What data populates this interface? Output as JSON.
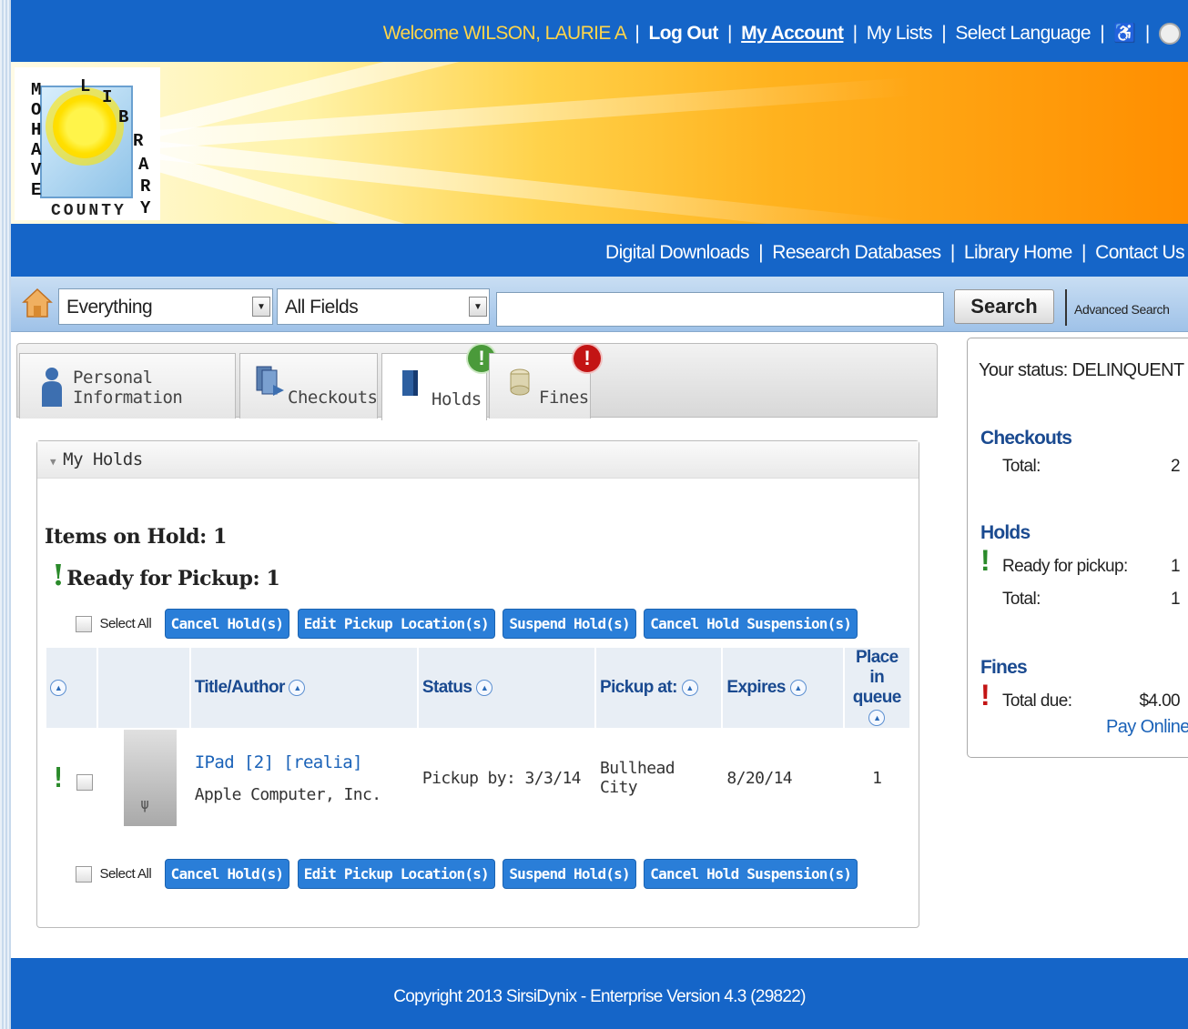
{
  "topbar": {
    "welcome": "Welcome WILSON, LAURIE A",
    "logout": "Log Out",
    "my_account": "My Account",
    "my_lists": "My Lists",
    "select_language": "Select Language",
    "separator": "|"
  },
  "logo": {
    "letters_left": [
      "M",
      "O",
      "H",
      "A",
      "V",
      "E"
    ],
    "letters_arc": [
      "L",
      "I",
      "B",
      "R",
      "A",
      "R",
      "Y"
    ],
    "county": "COUNTY"
  },
  "navbar": {
    "items": [
      "Digital Downloads",
      "Research Databases",
      "Library Home",
      "Contact Us"
    ],
    "separator": "|"
  },
  "search": {
    "scope_value": "Everything",
    "field_value": "All Fields",
    "query_value": "",
    "button_label": "Search",
    "advanced_label": "Advanced Search"
  },
  "tabs": {
    "personal": "Personal Information",
    "checkouts": "Checkouts",
    "holds": "Holds",
    "fines": "Fines",
    "badge": "!"
  },
  "holds": {
    "panel_title": "My Holds",
    "items_on_hold": "Items on Hold: 1",
    "ready_for_pickup": "Ready for Pickup: 1",
    "select_all": "Select All",
    "buttons": [
      "Cancel Hold(s)",
      "Edit Pickup Location(s)",
      "Suspend Hold(s)",
      "Cancel Hold Suspension(s)"
    ],
    "columns": {
      "title_author": "Title/Author",
      "status": "Status",
      "pickup_at": "Pickup at:",
      "expires": "Expires",
      "place_in_queue": "Place in queue"
    },
    "rows": [
      {
        "title": "IPad [2] [realia]",
        "author": "Apple Computer, Inc.",
        "status": "Pickup by: 3/3/14",
        "pickup_at": "Bullhead City",
        "expires": "8/20/14",
        "place": "1"
      }
    ]
  },
  "status_box": {
    "status": "Your status: DELINQUENT",
    "checkouts_heading": "Checkouts",
    "checkouts_total_label": "Total:",
    "checkouts_total": "2",
    "holds_heading": "Holds",
    "ready_label": "Ready for pickup:",
    "ready_value": "1",
    "holds_total_label": "Total:",
    "holds_total": "1",
    "fines_heading": "Fines",
    "total_due_label": "Total due:",
    "total_due": "$4.00",
    "pay_online": "Pay Online"
  },
  "footer": {
    "copyright": "Copyright 2013 SirsiDynix - Enterprise Version 4.3 (29822)"
  },
  "colors": {
    "brand_blue": "#1565c8",
    "welcome_yellow": "#ffd54a",
    "ok_green": "#2a8a2a",
    "alert_red": "#c31414"
  }
}
